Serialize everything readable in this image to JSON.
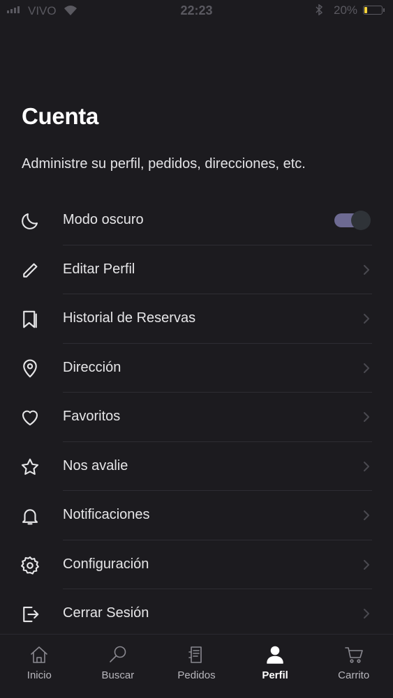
{
  "status_bar": {
    "carrier": "VIVO",
    "time": "22:23",
    "battery": "20%"
  },
  "header": {
    "title": "Cuenta",
    "subtitle": "Administre su perfil, pedidos, direcciones, etc."
  },
  "menu": {
    "items": [
      {
        "label": "Modo oscuro",
        "icon": "moon-icon",
        "toggle_on": true
      },
      {
        "label": "Editar Perfil",
        "icon": "pencil-icon"
      },
      {
        "label": "Historial de Reservas",
        "icon": "bookmarks-icon"
      },
      {
        "label": "Dirección",
        "icon": "map-pin-icon"
      },
      {
        "label": "Favoritos",
        "icon": "heart-icon"
      },
      {
        "label": "Nos avalie",
        "icon": "star-icon"
      },
      {
        "label": "Notificaciones",
        "icon": "bell-icon"
      },
      {
        "label": "Configuración",
        "icon": "gear-icon"
      },
      {
        "label": "Cerrar Sesión",
        "icon": "logout-icon"
      }
    ]
  },
  "tab_bar": {
    "tabs": [
      {
        "label": "Inicio",
        "icon": "home-icon"
      },
      {
        "label": "Buscar",
        "icon": "search-icon"
      },
      {
        "label": "Pedidos",
        "icon": "receipt-icon"
      },
      {
        "label": "Perfil",
        "icon": "person-icon",
        "active": true
      },
      {
        "label": "Carrito",
        "icon": "cart-icon"
      }
    ]
  },
  "colors": {
    "background": "#1c1b1f",
    "toggle_track": "#6d6a92",
    "battery_fill": "#f4d23a"
  }
}
